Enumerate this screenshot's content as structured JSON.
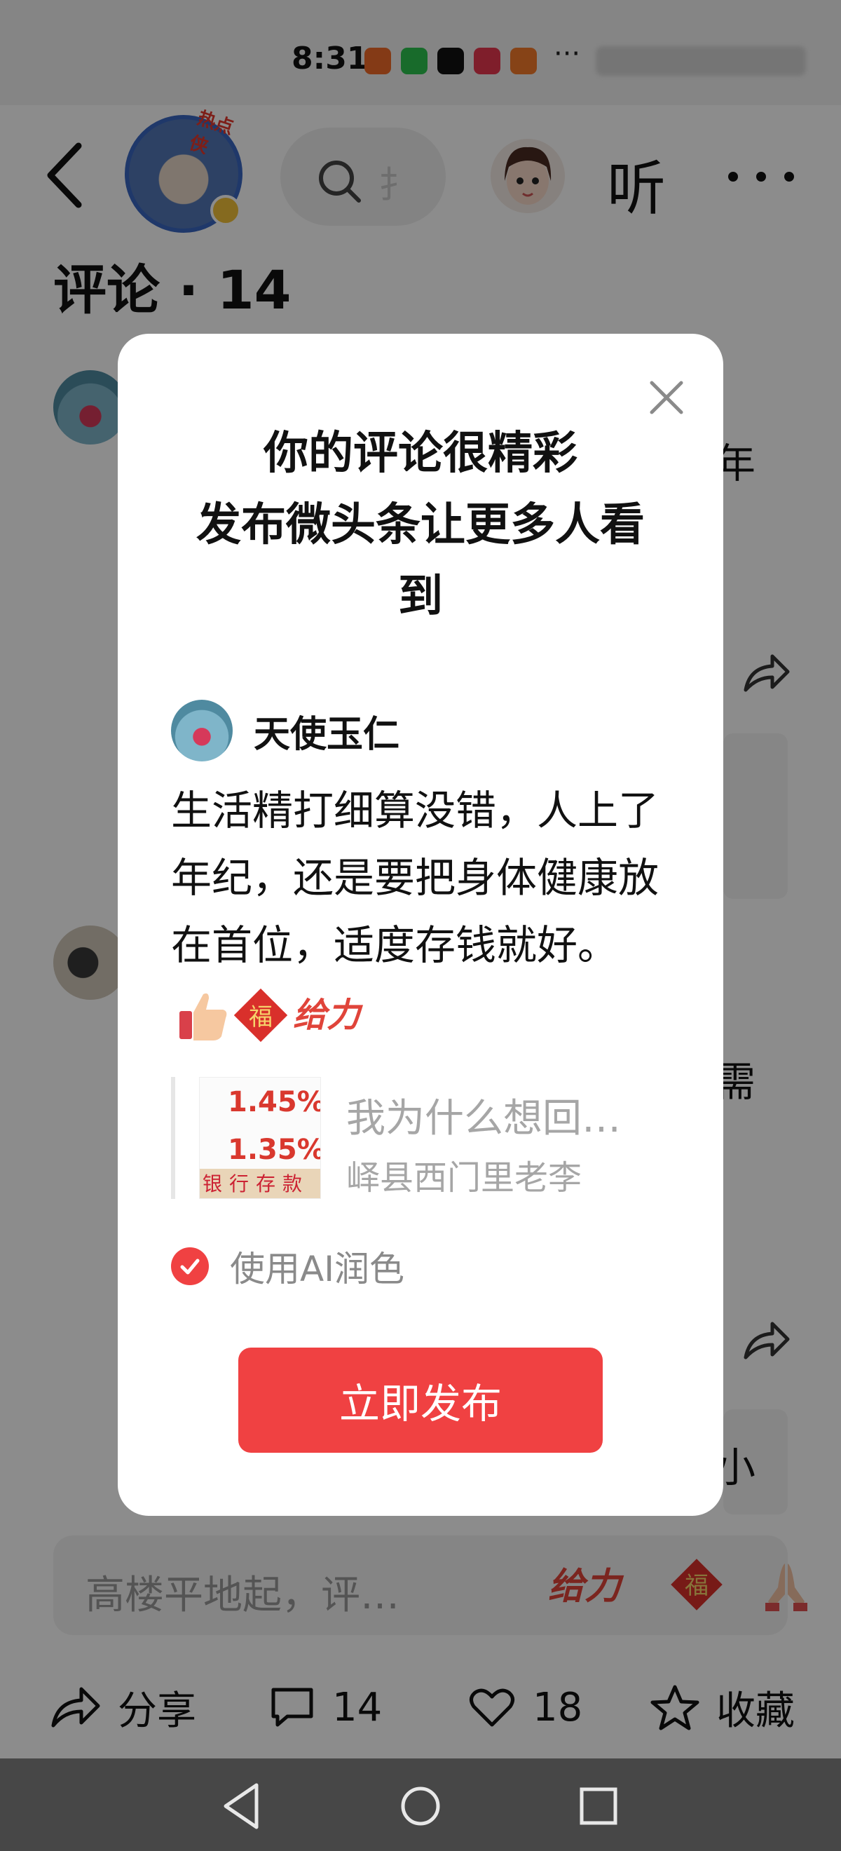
{
  "status_bar": {
    "time": "8:31",
    "more": "···"
  },
  "header": {
    "avatar_tag": "热点侠",
    "search_partial": "扌",
    "listen_label": "听"
  },
  "comments": {
    "title": "评论 · 14"
  },
  "background_fragments": {
    "frag1": "年",
    "frag2": "需",
    "frag3": "小"
  },
  "modal": {
    "title_line1": "你的评论很精彩",
    "title_line2": "发布微头条让更多人看",
    "title_line3": "到",
    "user_name": "天使玉仁",
    "comment_text": "生活精打细算没错，人上了年纪，还是要把身体健康放在首位，适度存钱就好。",
    "emoji": [
      "thumbs-up",
      "fu",
      "jili"
    ],
    "emoji_fu_text": "福",
    "emoji_jili_text": "给力",
    "quote": {
      "thumb_rate1": "1.45%",
      "thumb_rate2": "1.35%",
      "thumb_strip": "银行存款",
      "title": "我为什么想回…",
      "author": "峄县西门里老李"
    },
    "ai_option": {
      "label": "使用AI润色",
      "checked": true
    },
    "publish_label": "立即发布"
  },
  "input_bar": {
    "placeholder": "高楼平地起，评…",
    "sticker_jili": "给力",
    "sticker_fu": "福"
  },
  "action_bar": {
    "share_label": "分享",
    "comment_count": "14",
    "like_count": "18",
    "favorite_label": "收藏"
  },
  "colors": {
    "accent_red": "#f04142",
    "overlay": "rgba(0,0,0,0.45)"
  }
}
